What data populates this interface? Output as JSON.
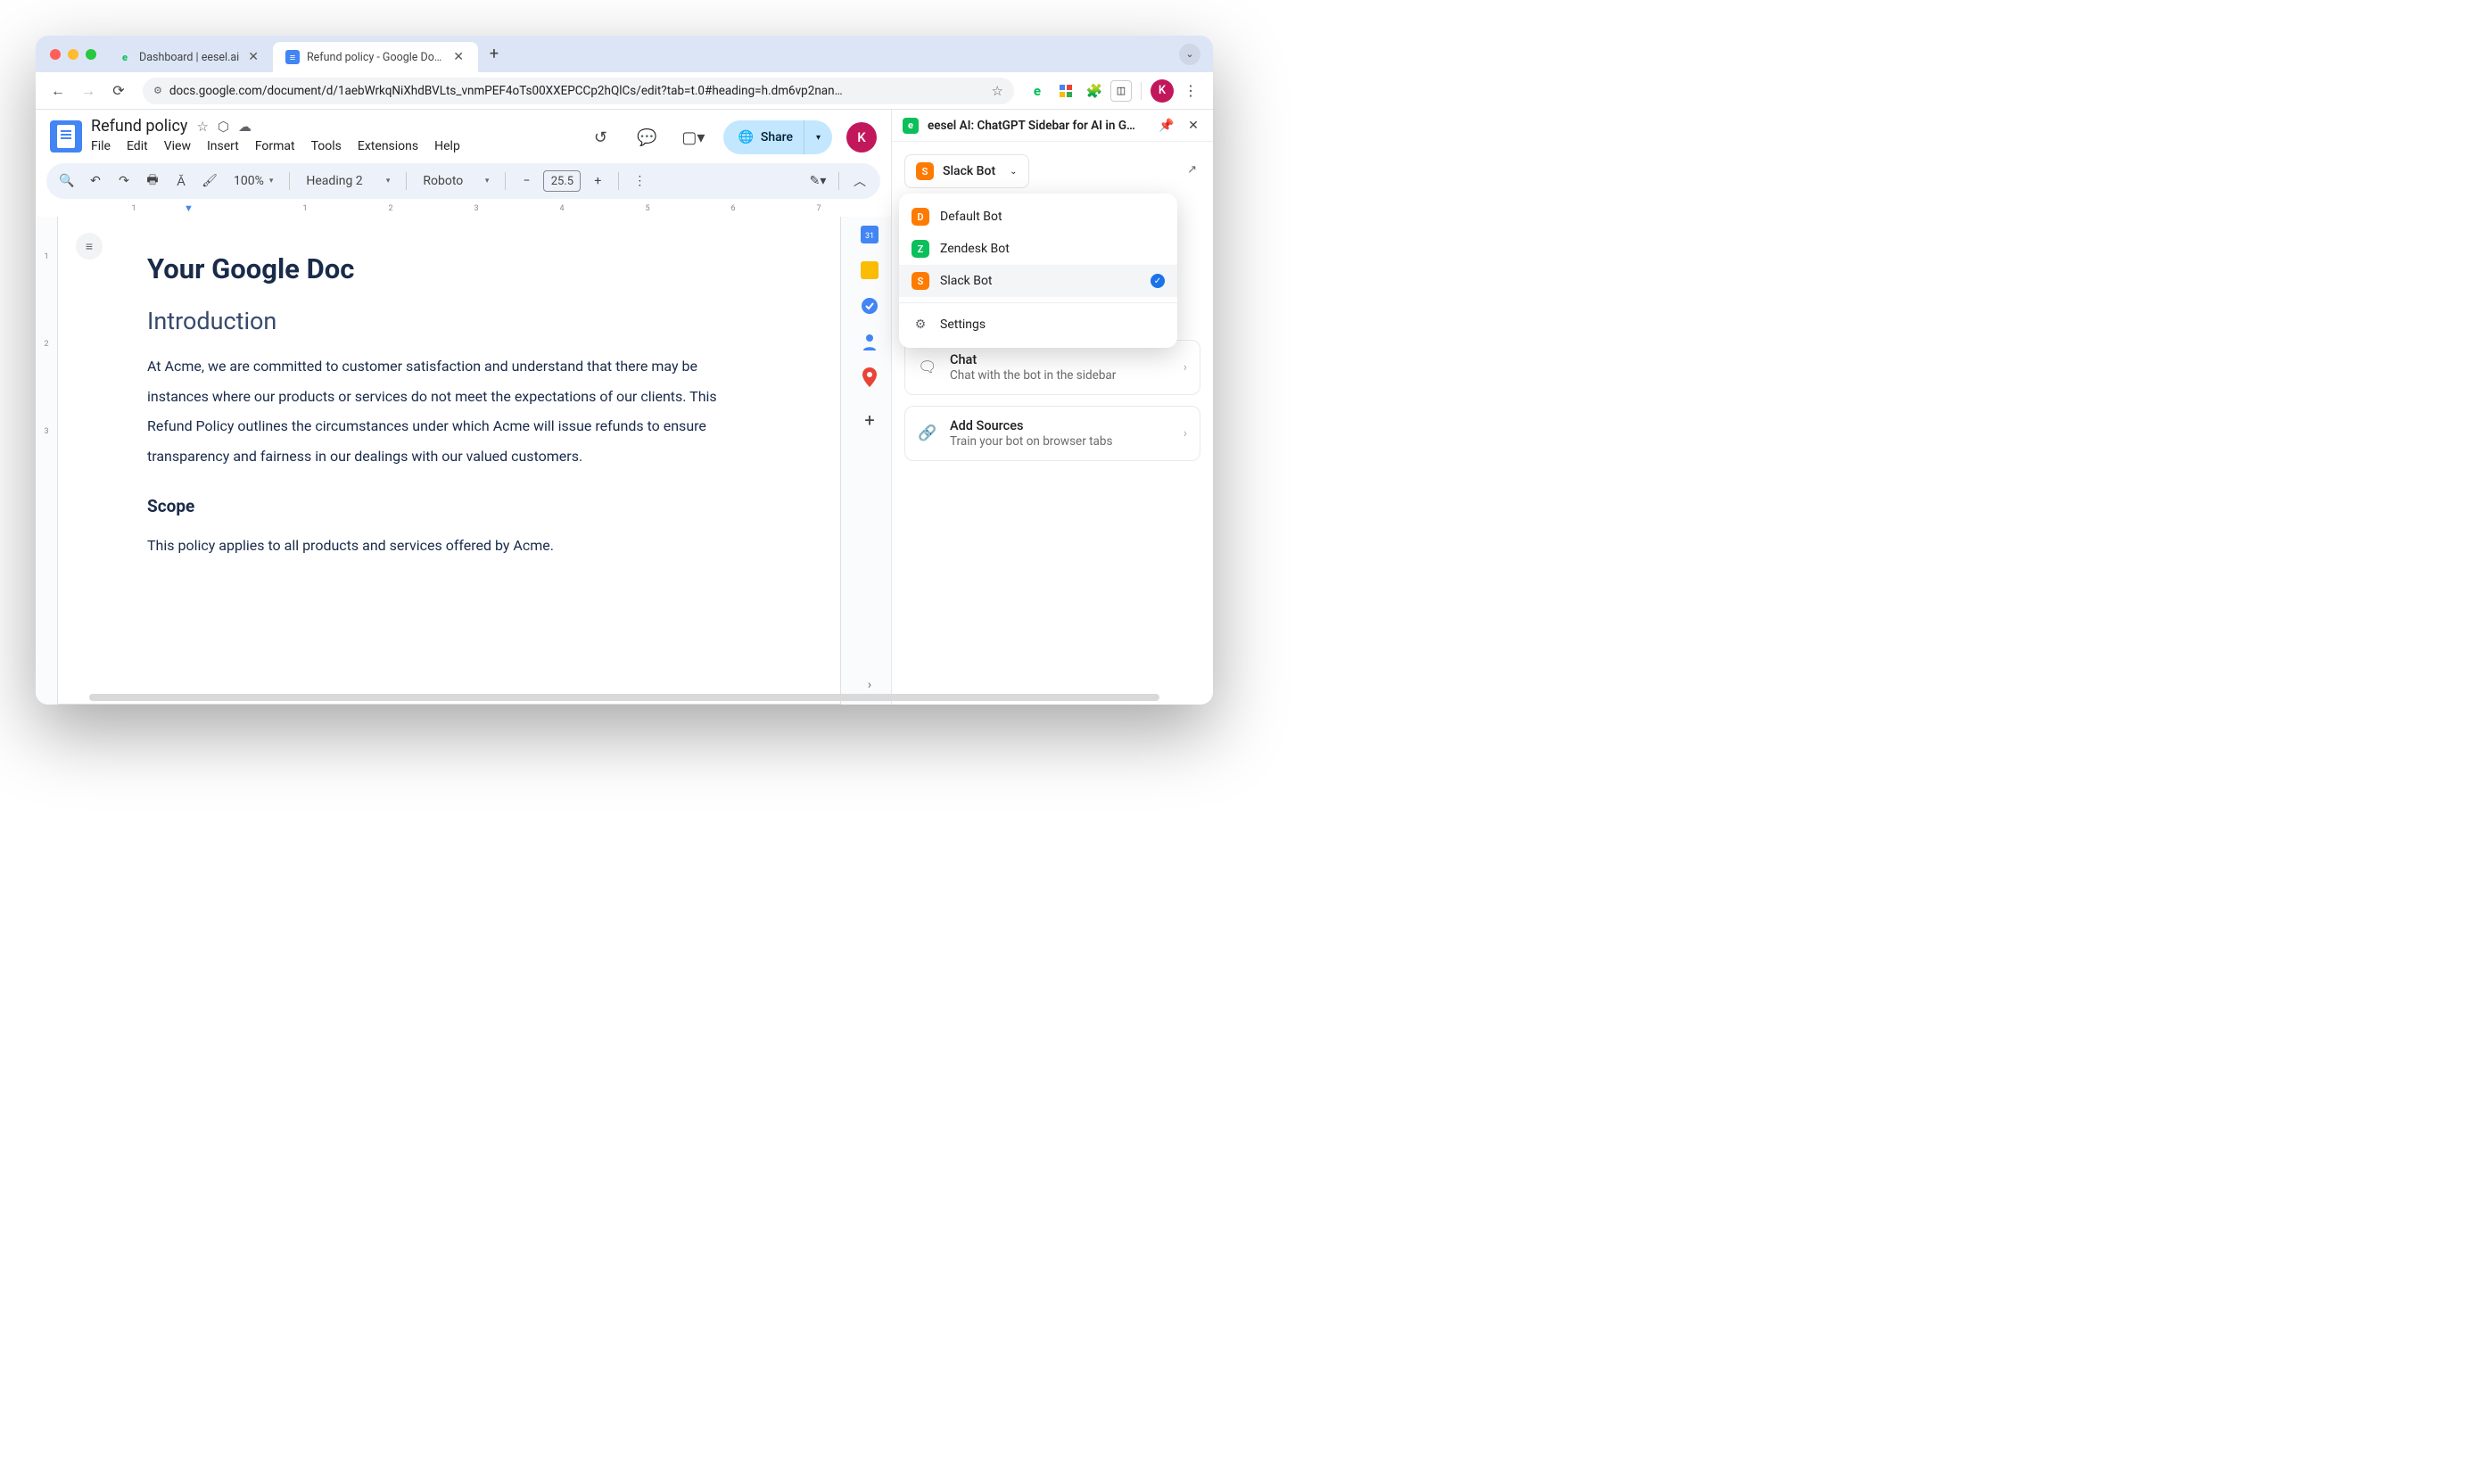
{
  "tabs": [
    {
      "title": "Dashboard | eesel.ai",
      "favicon": "e",
      "favcolor": "#0bbf5b"
    },
    {
      "title": "Refund policy - Google Docs",
      "favicon": "docs"
    }
  ],
  "url": "docs.google.com/document/d/1aebWrkqNiXhdBVLts_vnmPEF4oTs00XXEPCCp2hQlCs/edit?tab=t.0#heading=h.dm6vp2nan…",
  "doc": {
    "title": "Refund policy",
    "menus": [
      "File",
      "Edit",
      "View",
      "Insert",
      "Format",
      "Tools",
      "Extensions",
      "Help"
    ],
    "share_label": "Share"
  },
  "toolbar": {
    "zoom": "100%",
    "style": "Heading 2",
    "font": "Roboto",
    "size": "25.5"
  },
  "ruler_h": [
    "1",
    "",
    "1",
    "2",
    "3",
    "4",
    "5",
    "6",
    "7"
  ],
  "ruler_v": [
    "1",
    "2",
    "3"
  ],
  "content": {
    "h1": "Your Google Doc",
    "h2": "Introduction",
    "p1": "At Acme, we are committed to customer satisfaction and understand that there may be instances where our products or services do not meet the expectations of our clients. This Refund Policy outlines the circumstances under which Acme will issue refunds to ensure transparency and fairness in our dealings with our valued customers.",
    "h3": "Scope",
    "p2": "This policy applies to all products and services offered by Acme."
  },
  "ext": {
    "title": "eesel AI: ChatGPT Sidebar for AI in G…",
    "selected_bot": "Slack Bot",
    "bots": [
      {
        "badge": "D",
        "color": "#ff7a00",
        "name": "Default Bot"
      },
      {
        "badge": "Z",
        "color": "#0bbf5b",
        "name": "Zendesk Bot"
      },
      {
        "badge": "S",
        "color": "#ff7a00",
        "name": "Slack Bot",
        "selected": true
      }
    ],
    "settings_label": "Settings",
    "cards": [
      {
        "icon": "💬",
        "title": "Chat",
        "sub": "Chat with the bot in the sidebar"
      },
      {
        "icon": "🔗",
        "title": "Add Sources",
        "sub": "Train your bot on browser tabs"
      }
    ]
  },
  "avatar_letter": "K"
}
